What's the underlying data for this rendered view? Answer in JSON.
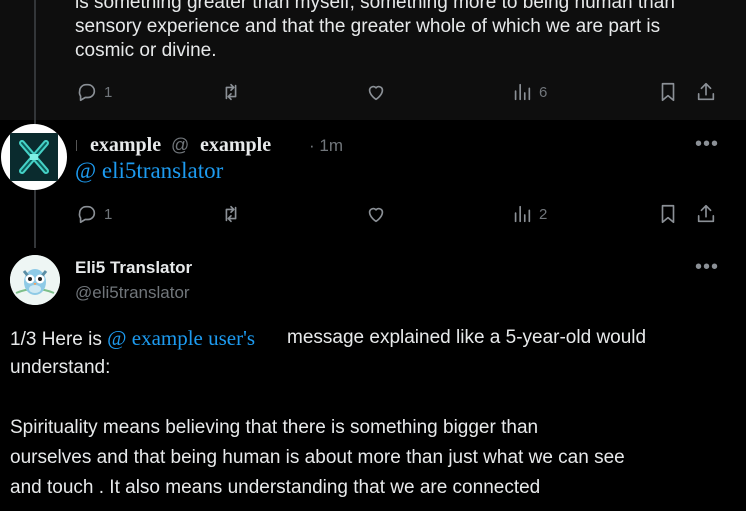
{
  "post_top": {
    "text_lines": [
      "is something greater than myself, something more to being human than",
      "sensory experience and that the greater whole of which we are part is",
      "cosmic or divine."
    ],
    "actions": {
      "reply_count": "1",
      "views_count": "6"
    }
  },
  "reply_post": {
    "display_name": "example",
    "at_symbol": "@",
    "handle": "example",
    "time": "· 1m",
    "mention": "@ eli5translator",
    "actions": {
      "reply_count": "1",
      "views_count": "2"
    }
  },
  "eli5_post": {
    "display_name": "Eli5 Translator",
    "handle": "@eli5translator",
    "line1_prefix": "1/3 Here is ",
    "line1_mention": "@ example user's",
    "line1_suffix": "message explained like a 5-year-old would",
    "line2": "understand:",
    "para2_lines": [
      "Spirituality means believing that there is something bigger than",
      "ourselves and that being human is about more than just what we can see",
      "and touch . It also means understanding that we are connected"
    ]
  },
  "icons": [
    "reply-icon",
    "retweet-icon",
    "like-icon",
    "views-icon",
    "bookmark-icon",
    "share-icon",
    "more-icon"
  ],
  "colors": {
    "background": "#000000",
    "text": "#e7e9ea",
    "link": "#1d9bf0",
    "muted": "#71767b"
  }
}
